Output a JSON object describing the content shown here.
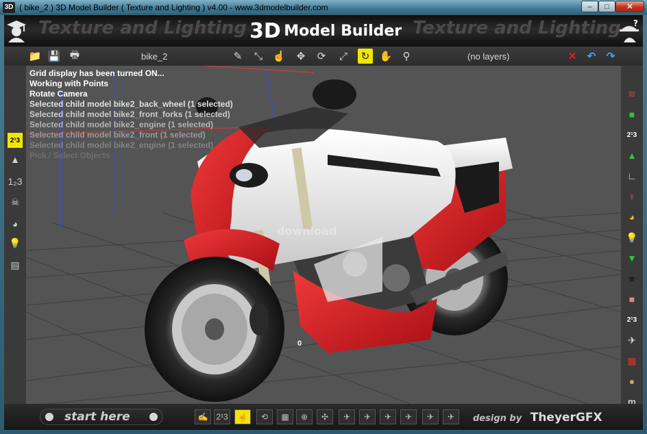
{
  "window": {
    "app_icon": "3D",
    "title": "( bike_2 ) 3D Model Builder ( Texture and Lighting ) v4.00 - www.3dmodelbuilder.com",
    "minimize_label": "–",
    "maximize_label": "□",
    "close_label": "✕"
  },
  "banner": {
    "ghost_left": "Texture and Lighting",
    "ghost_right": "Texture and Lighting",
    "brand_3d": "3D",
    "brand_rest": "Model Builder",
    "left_icon": "student-graduate-icon",
    "right_icon": "help-detective-icon"
  },
  "toolbar": {
    "file_name": "bike_2",
    "layers_label": "(no layers)",
    "left_icons": [
      "open-folder-icon",
      "save-disk-icon",
      "print-icon"
    ],
    "mode_icons": [
      "pencil-icon",
      "axis-scale-icon",
      "hand-point-icon",
      "move-icon",
      "rotate-icon",
      "scale-icon",
      "orbit-icon",
      "pan-hand-icon",
      "zoom-magnifier-icon"
    ],
    "active_mode": "orbit-icon",
    "right_icons": [
      "delete-x-icon",
      "undo-icon",
      "redo-icon"
    ]
  },
  "log": {
    "lines": [
      {
        "text": "Grid display has been turned ON...",
        "color": "#ffffff"
      },
      {
        "text": "Working with Points",
        "color": "#ffffff"
      },
      {
        "text": "Rotate Camera",
        "color": "#ffffff"
      },
      {
        "text": "Selected child model bike2_back_wheel (1 selected)",
        "color": "#e0e0e0"
      },
      {
        "text": "Selected child model bike2_front_forks (1 selected)",
        "color": "#cccccc"
      },
      {
        "text": "Selected child model bike2_engine (1 selected)",
        "color": "#b4b4b4"
      },
      {
        "text": "Selected child model bike2_front (1 selected)",
        "color": "#9a9a9a"
      },
      {
        "text": "Selected child model bike2_engine (1 selected)",
        "color": "#838383"
      },
      {
        "text": "Pick / Select Objects",
        "color": "#6e6e6e"
      }
    ]
  },
  "viewport": {
    "watermark": "download",
    "vertex_label": "0"
  },
  "left_sidebar": {
    "icons": [
      {
        "name": "number-order-icon",
        "glyph": "2¹3",
        "active": true
      },
      {
        "name": "triangle-icon",
        "glyph": "▲",
        "active": false
      },
      {
        "name": "number-sequence-icon",
        "glyph": "1₂3",
        "active": false
      },
      {
        "name": "figure-icon",
        "glyph": "☠",
        "active": false
      },
      {
        "name": "palette-icon",
        "glyph": "◕",
        "active": false
      },
      {
        "name": "lightbulb-icon",
        "glyph": "💡",
        "active": false
      },
      {
        "name": "layers-stack-icon",
        "glyph": "▤",
        "active": false
      }
    ]
  },
  "right_sidebar": {
    "icons": [
      {
        "name": "texture-layers-icon",
        "glyph": "≋"
      },
      {
        "name": "color-cube-icon",
        "glyph": "■"
      },
      {
        "name": "number-order-icon",
        "glyph": "2¹3"
      },
      {
        "name": "green-triangle-icon",
        "glyph": "▲"
      },
      {
        "name": "axis-corner-icon",
        "glyph": "∟"
      },
      {
        "name": "figure-pink-icon",
        "glyph": "♀"
      },
      {
        "name": "palette-icon",
        "glyph": "◕"
      },
      {
        "name": "lightbulb-icon",
        "glyph": "💡"
      },
      {
        "name": "arrow-down-green-icon",
        "glyph": "▼"
      },
      {
        "name": "dark-cube-icon",
        "glyph": "■"
      },
      {
        "name": "pink-cube-icon",
        "glyph": "■"
      },
      {
        "name": "number-order-icon",
        "glyph": "2¹3"
      },
      {
        "name": "jet-icon",
        "glyph": "✈"
      },
      {
        "name": "rubik-cube-icon",
        "glyph": "▦"
      },
      {
        "name": "sphere-icon",
        "glyph": "●"
      },
      {
        "name": "m-logo-icon",
        "glyph": "m"
      }
    ]
  },
  "bottombar": {
    "start_label": "start here",
    "credit_label": "design by",
    "credit_brand": "TheyerGFX",
    "icons": [
      {
        "name": "sketch-figure-icon",
        "glyph": "✍",
        "active": false
      },
      {
        "name": "number-order-icon",
        "glyph": "2¹3",
        "active": false
      },
      {
        "name": "hand-select-icon",
        "glyph": "☝",
        "active": true
      },
      {
        "name": "rotate-arrows-icon",
        "glyph": "⟲",
        "active": false
      },
      {
        "name": "grid-wire-icon",
        "glyph": "▦",
        "active": false
      },
      {
        "name": "crosshair-icon",
        "glyph": "⊕",
        "active": false
      },
      {
        "name": "expand-arrows-icon",
        "glyph": "✣",
        "active": false
      },
      {
        "name": "jet-1-icon",
        "glyph": "✈",
        "active": false
      },
      {
        "name": "jet-2-icon",
        "glyph": "✈",
        "active": false
      },
      {
        "name": "jet-3-icon",
        "glyph": "✈",
        "active": false
      },
      {
        "name": "jet-4-icon",
        "glyph": "✈",
        "active": false
      },
      {
        "name": "jet-5-icon",
        "glyph": "✈",
        "active": false
      },
      {
        "name": "jet-6-icon",
        "glyph": "✈",
        "active": false
      }
    ]
  },
  "colors": {
    "bike_red": "#d0151e",
    "bike_white": "#ededed",
    "active_yellow": "#f2e600",
    "viewport_bg": "#545454"
  }
}
